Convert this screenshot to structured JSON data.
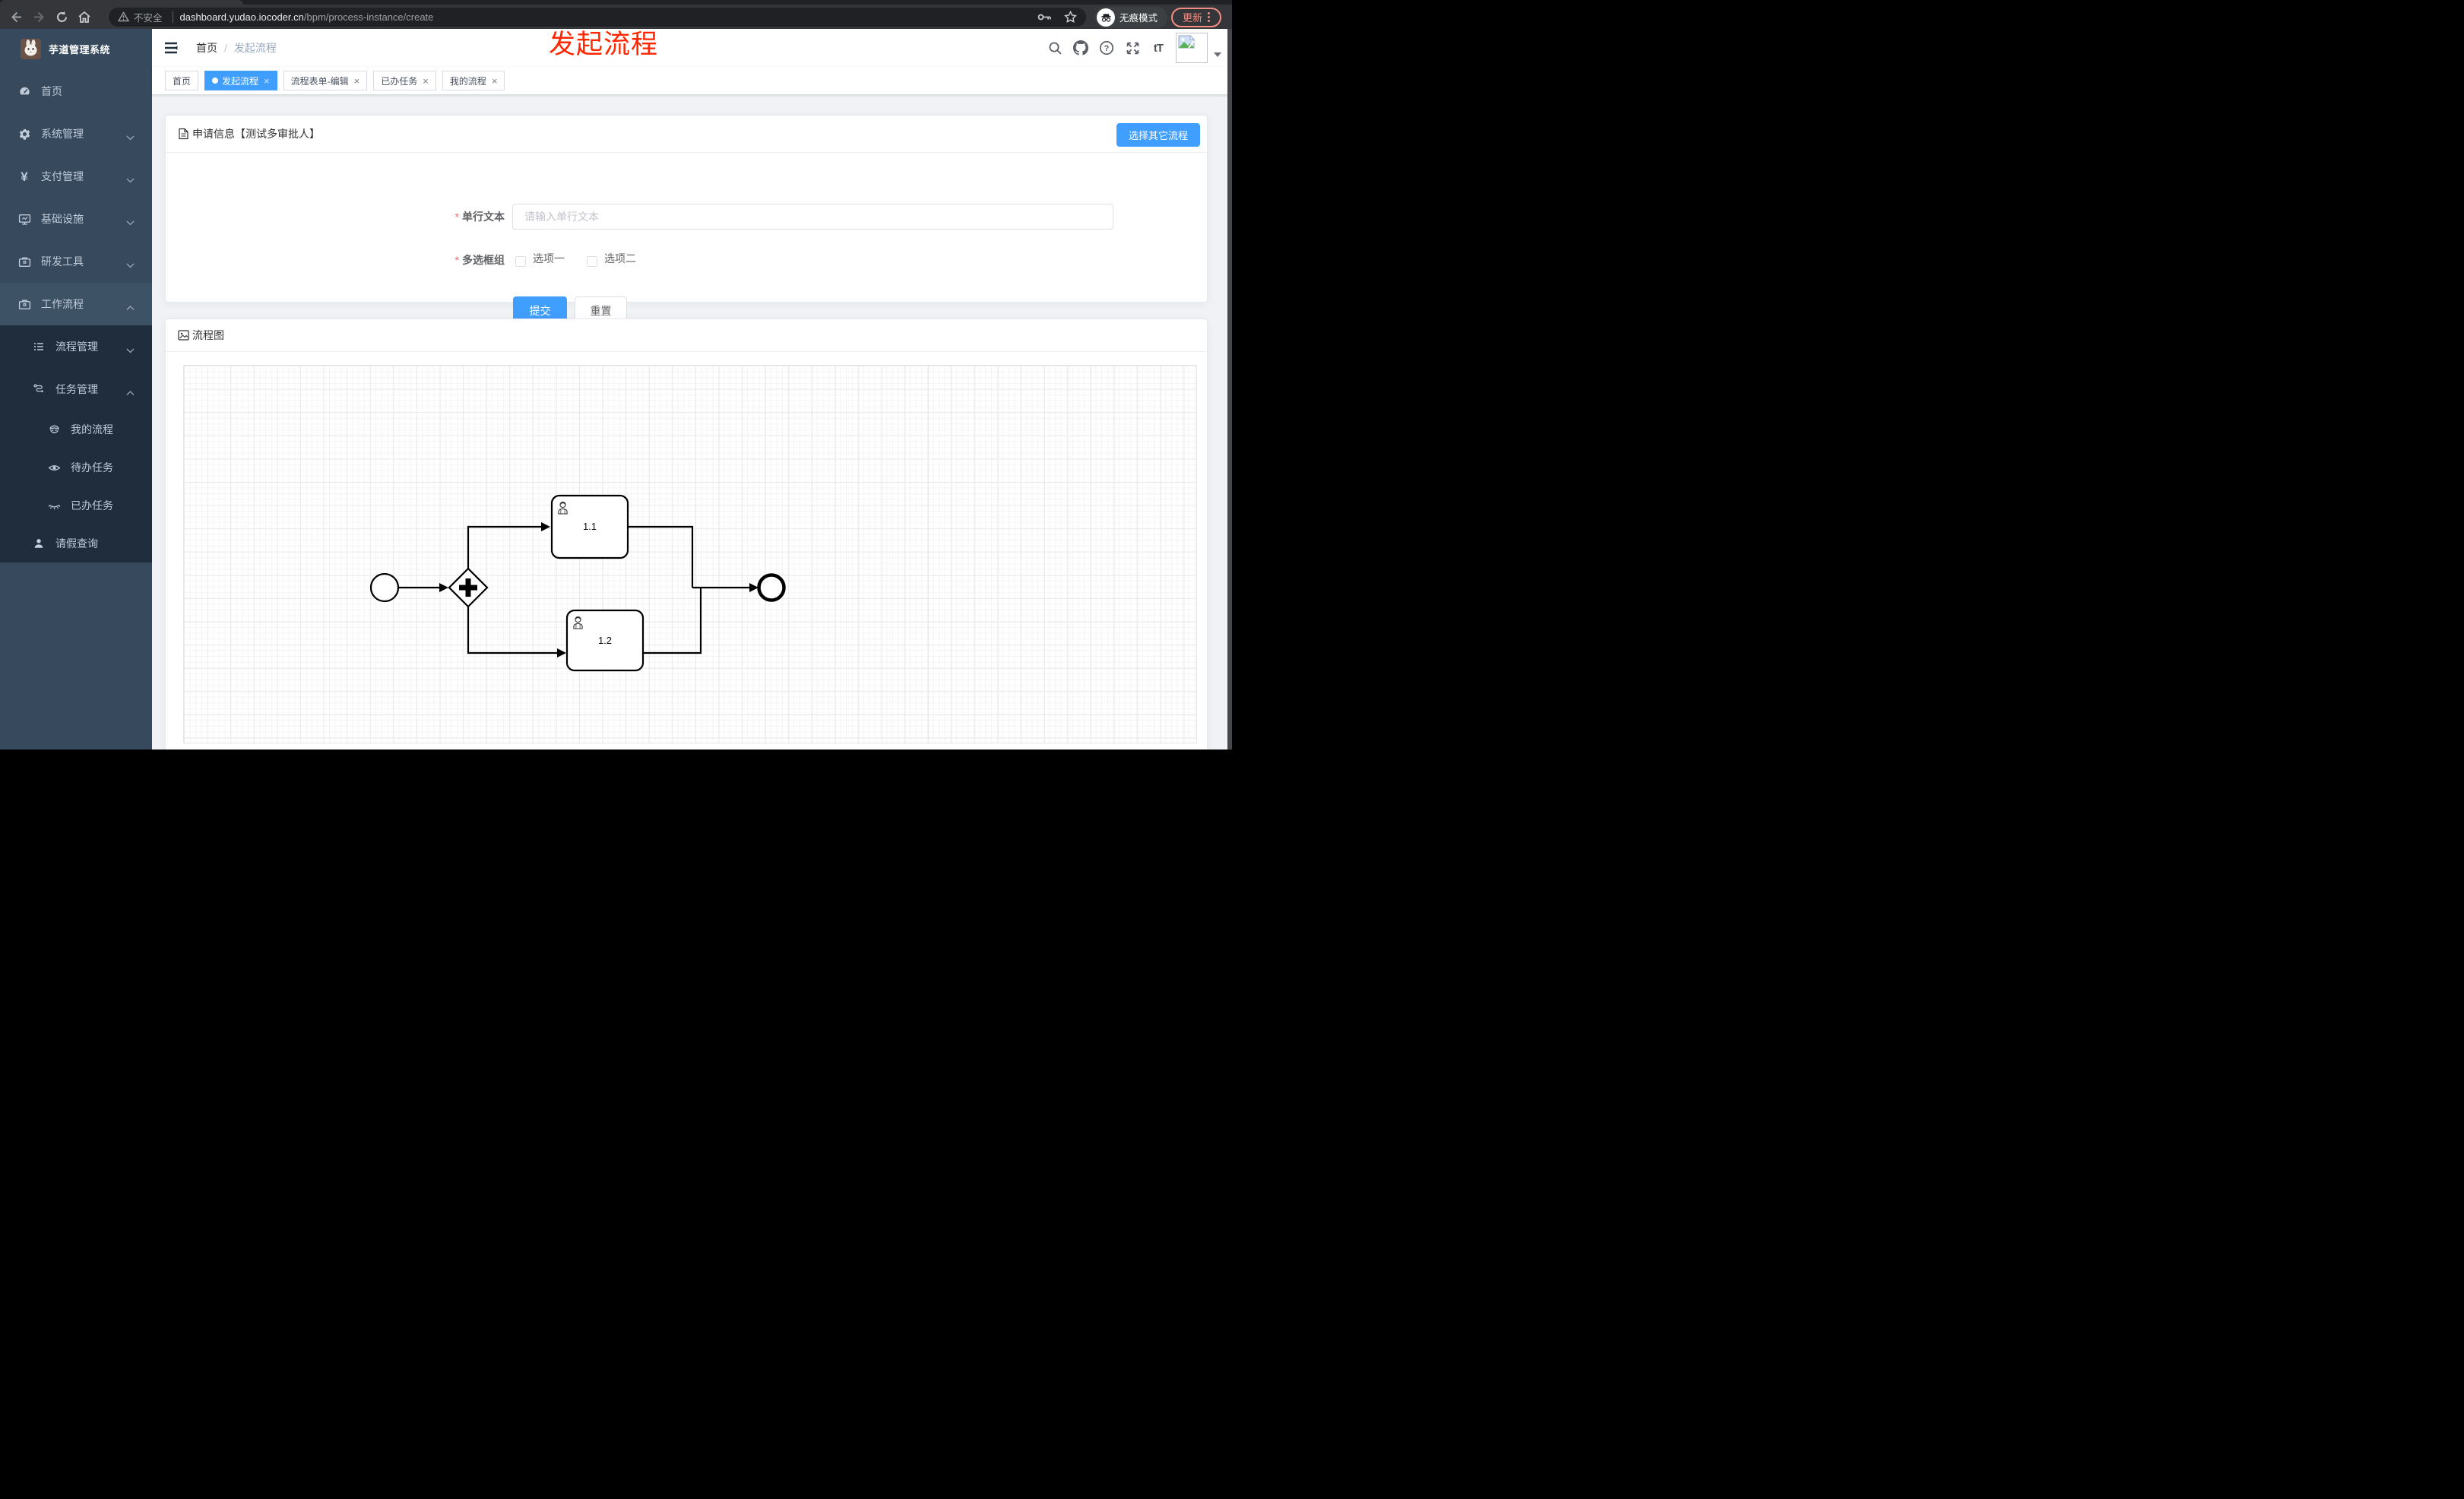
{
  "browser": {
    "security_label": "不安全",
    "url_domain": "dashboard.yudao.iocoder.cn",
    "url_path": "/bpm/process-instance/create",
    "incognito_label": "无痕模式",
    "update_label": "更新",
    "icons": [
      "back-icon",
      "forward-icon",
      "reload-icon",
      "home-icon",
      "warning-icon",
      "key-icon",
      "star-icon",
      "incognito-icon",
      "more-vert-icon"
    ]
  },
  "annotation": {
    "text": "发起流程",
    "color": "#FF2600"
  },
  "sidebar": {
    "title": "芋道管理系统",
    "logo_icon": "rabbit-avatar",
    "items": [
      {
        "label": "首页",
        "icon": "dashboard-icon",
        "level": 1
      },
      {
        "label": "系统管理",
        "icon": "gear-icon",
        "level": 1,
        "chevron": "down"
      },
      {
        "label": "支付管理",
        "icon": "yen-icon",
        "level": 1,
        "chevron": "down"
      },
      {
        "label": "基础设施",
        "icon": "monitor-icon",
        "level": 1,
        "chevron": "down"
      },
      {
        "label": "研发工具",
        "icon": "toolbox-icon",
        "level": 1,
        "chevron": "down"
      },
      {
        "label": "工作流程",
        "icon": "toolbox-icon",
        "level": 1,
        "chevron": "up",
        "expanded": true
      },
      {
        "label": "流程管理",
        "icon": "list-icon",
        "level": 2,
        "chevron": "down"
      },
      {
        "label": "任务管理",
        "icon": "flow-icon",
        "level": 2,
        "chevron": "up",
        "expanded": true
      },
      {
        "label": "我的流程",
        "icon": "face-icon",
        "level": 3
      },
      {
        "label": "待办任务",
        "icon": "eye-icon",
        "level": 3
      },
      {
        "label": "已办任务",
        "icon": "eye-closed-icon",
        "level": 3
      },
      {
        "label": "请假查询",
        "icon": "user-icon",
        "level": 2
      }
    ]
  },
  "navbar": {
    "breadcrumb_home": "首页",
    "breadcrumb_current": "发起流程",
    "font_size_glyph": "tT",
    "icons": [
      "hamburger-icon",
      "search-icon",
      "github-icon",
      "help-icon",
      "fullscreen-icon",
      "font-size-icon",
      "avatar-placeholder",
      "caret-down-icon"
    ]
  },
  "tags": [
    {
      "label": "首页",
      "active": false,
      "closable": false
    },
    {
      "label": "发起流程",
      "active": true,
      "closable": true
    },
    {
      "label": "流程表单-编辑",
      "active": false,
      "closable": true
    },
    {
      "label": "已办任务",
      "active": false,
      "closable": true
    },
    {
      "label": "我的流程",
      "active": false,
      "closable": true
    }
  ],
  "form_card": {
    "title": "申请信息【测试多审批人】",
    "title_icon": "document-icon",
    "select_other": "选择其它流程",
    "text_field": {
      "label": "单行文本",
      "placeholder": "请输入单行文本",
      "required": true,
      "value": ""
    },
    "checkbox_field": {
      "label": "多选框组",
      "required": true,
      "options": [
        "选项一",
        "选项二"
      ],
      "checked": [
        false,
        false
      ]
    },
    "submit": "提交",
    "reset": "重置"
  },
  "diagram_card": {
    "title": "流程图",
    "title_icon": "picture-icon",
    "type": "bpmn",
    "nodes": [
      "start-event",
      "parallel-gateway",
      "user-task-1.1",
      "user-task-1.2",
      "end-event"
    ],
    "tasks": [
      {
        "label": "1.1"
      },
      {
        "label": "1.2"
      }
    ]
  },
  "colors": {
    "primary": "#409EFF",
    "annotation_red": "#FF2600",
    "sidebar_bg": "#36495D",
    "submenu_bg": "#1F2D3D",
    "update_red": "#F28B82",
    "chrome_bg": "#35363A",
    "urlbar_bg": "#202124"
  }
}
